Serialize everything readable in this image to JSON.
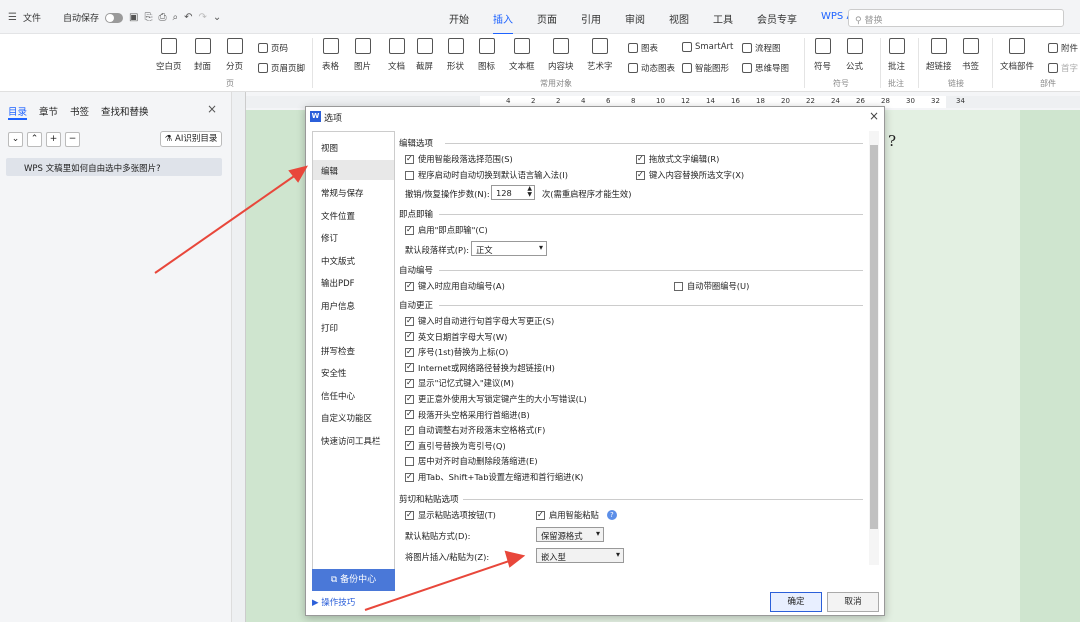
{
  "titlebar": {
    "menu_icon": "hamburger-icon",
    "file_label": "文件",
    "autosave_label": "自动保存",
    "tabs": [
      "开始",
      "插入",
      "页面",
      "引用",
      "审阅",
      "视图",
      "工具",
      "会员专享",
      "WPS AI"
    ],
    "active_tab": "插入",
    "search_placeholder": "替换"
  },
  "ribbon": {
    "buttons": [
      {
        "label": "空白页"
      },
      {
        "label": "封面"
      },
      {
        "label": "分页"
      },
      {
        "label": "表格"
      },
      {
        "label": "图片"
      },
      {
        "label": "文档"
      },
      {
        "label": "截屏"
      },
      {
        "label": "形状"
      },
      {
        "label": "图标"
      },
      {
        "label": "文本框"
      },
      {
        "label": "内容块"
      },
      {
        "label": "艺术字"
      },
      {
        "label": "符号"
      },
      {
        "label": "公式"
      },
      {
        "label": "批注"
      },
      {
        "label": "超链接"
      },
      {
        "label": "书签"
      },
      {
        "label": "文档部件"
      }
    ],
    "small_buttons": {
      "header": "页码",
      "footer": "页眉页脚",
      "chart": "图表",
      "dyn_chart": "动态图表",
      "smartart": "SmartArt",
      "smart_shape": "智能图形",
      "flowchart": "流程图",
      "mindmap": "思维导图",
      "attachment": "附件",
      "first_char": "首字"
    },
    "groups": {
      "page": "页",
      "common": "常用对象",
      "symbol": "符号",
      "comment": "批注",
      "link": "链接",
      "part": "部件"
    }
  },
  "navpane": {
    "tabs": [
      "目录",
      "章节",
      "书签",
      "查找和替换"
    ],
    "ai_button": "AI识别目录",
    "item": "WPS 文稿里如何自由选中多张图片?"
  },
  "ruler": {
    "numbers": [
      "4",
      "2",
      "2",
      "4",
      "6",
      "8",
      "10",
      "12",
      "14",
      "16",
      "18",
      "20",
      "22",
      "24",
      "26",
      "28",
      "30",
      "32",
      "34"
    ]
  },
  "document": {
    "visible_text": "?"
  },
  "dialog": {
    "title": "选项",
    "sidebar": [
      "视图",
      "编辑",
      "常规与保存",
      "文件位置",
      "修订",
      "中文版式",
      "输出PDF",
      "用户信息",
      "打印",
      "拼写检查",
      "安全性",
      "信任中心",
      "自定义功能区",
      "快速访问工具栏"
    ],
    "selected": "编辑",
    "backup": "备份中心",
    "tips": "操作技巧",
    "sections": {
      "edit": {
        "title": "编辑选项",
        "opt1": "使用智能段落选择范围(S)",
        "opt2": "程序启动时自动切换到默认语言输入法(I)",
        "opt3": "拖放式文字编辑(R)",
        "opt4": "键入内容替换所选文字(X)",
        "undo_label": "撤销/恢复操作步数(N):",
        "undo_value": "128",
        "undo_hint": "次(需重启程序才能生效)"
      },
      "clickin": {
        "title": "即点即输",
        "enable": "启用\"即点即输\"(C)",
        "style_label": "默认段落样式(P):",
        "style_value": "正文"
      },
      "autonum": {
        "title": "自动编号",
        "opt1": "键入时应用自动编号(A)",
        "opt2": "自动带圈编号(U)"
      },
      "autocorrect": {
        "title": "自动更正",
        "items": [
          {
            "label": "键入时自动进行句首字母大写更正(S)",
            "on": true
          },
          {
            "label": "英文日期首字母大写(W)",
            "on": true
          },
          {
            "label": "序号(1st)替换为上标(O)",
            "on": true
          },
          {
            "label": "Internet或网络路径替换为超链接(H)",
            "on": true
          },
          {
            "label": "显示\"记忆式键入\"建议(M)",
            "on": true
          },
          {
            "label": "更正意外使用大写锁定键产生的大小写错误(L)",
            "on": true
          },
          {
            "label": "段落开头空格采用行首缩进(B)",
            "on": true
          },
          {
            "label": "自动调整右对齐段落末空格格式(F)",
            "on": true
          },
          {
            "label": "直引号替换为弯引号(Q)",
            "on": true
          },
          {
            "label": "居中对齐时自动删除段落缩进(E)",
            "on": false
          },
          {
            "label": "用Tab、Shift+Tab设置左缩进和首行缩进(K)",
            "on": true
          }
        ]
      },
      "paste": {
        "title": "剪切和粘贴选项",
        "show_btn": "显示粘贴选项按钮(T)",
        "smart_paste": "启用智能粘贴",
        "default_label": "默认粘贴方式(D):",
        "default_value": "保留源格式",
        "image_label": "将图片插入/粘贴为(Z):",
        "image_value": "嵌入型"
      }
    },
    "ok": "确定",
    "cancel": "取消"
  }
}
